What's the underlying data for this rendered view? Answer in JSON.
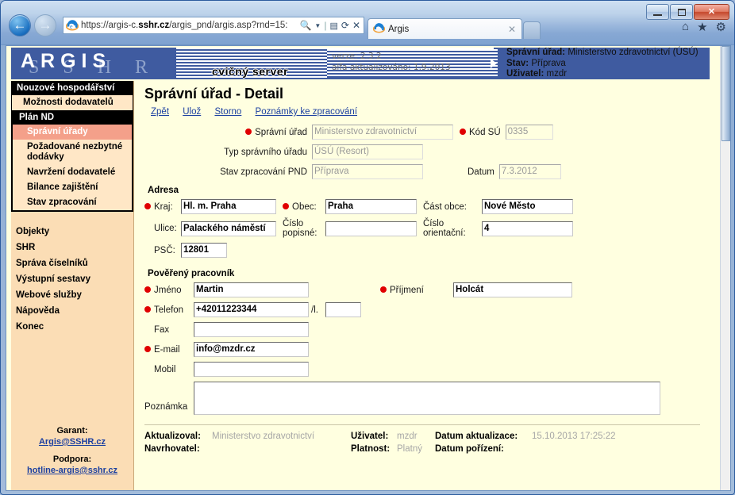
{
  "browser": {
    "url_prefix": "https://argis-c.",
    "url_domain": "sshr.cz",
    "url_suffix": "/argis_pnd/argis.asp?rnd=15:",
    "tab_title": "Argis",
    "search_icon": "search-icon",
    "compat_icon": "compatibility-view-icon",
    "refresh_icon": "refresh-icon",
    "stop_icon": "stop-icon",
    "home_icon": "home-icon",
    "favorites_icon": "star-icon",
    "tools_icon": "gear-icon",
    "minimize_label": "Minimize",
    "maximize_label": "Maximize",
    "close_label": "Close",
    "back_label": "Back",
    "forward_label": "Forward",
    "new_tab_label": "New tab",
    "tab_close_label": "Close tab"
  },
  "banner": {
    "logo": "ARGIS",
    "logo_ghost": "SSHR",
    "slogan": "cvičný server",
    "version_line1": "verze: 2.3.2",
    "version_line2": "alfa aktualizováno: 1.9.2013",
    "session": [
      {
        "label": "Správní úřad:",
        "value": "Ministerstvo zdravotnictví (ÚSÚ)"
      },
      {
        "label": "Stav:",
        "value": "Příprava"
      },
      {
        "label": "Uživatel:",
        "value": "mzdr"
      }
    ]
  },
  "sidebar": {
    "menu_header": "Nouzové hospodářství",
    "menu_item": "Možnosti dodavatelů",
    "submenu_header": "Plán ND",
    "submenu_items": [
      {
        "label": "Správní úřady",
        "active": true
      },
      {
        "label": "Požadované nezbytné dodávky",
        "active": false
      },
      {
        "label": "Navržení dodavatelé",
        "active": false
      },
      {
        "label": "Bilance zajištění",
        "active": false
      },
      {
        "label": "Stav zpracování",
        "active": false
      }
    ],
    "root_items": [
      "Objekty",
      "SHR",
      "Správa číselníků",
      "Výstupní sestavy",
      "Webové služby",
      "Nápověda",
      "Konec"
    ],
    "footer": {
      "garant_label": "Garant:",
      "garant_mail": "Argis@SSHR.cz",
      "podpora_label": "Podpora:",
      "podpora_mail": "hotline-argis@sshr.cz"
    }
  },
  "main": {
    "title": "Správní úřad - Detail",
    "actions": [
      "Zpět",
      "Ulož",
      "Storno",
      "Poznámky ke zpracování"
    ],
    "fields": {
      "spravni_urad_label": "Správní úřad",
      "spravni_urad_value": "Ministerstvo zdravotnictví",
      "kod_su_label": "Kód SÚ",
      "kod_su_value": "0335",
      "typ_label": "Typ správního úřadu",
      "typ_value": "ÚSÚ (Resort)",
      "stav_label": "Stav zpracování PND",
      "stav_value": "Příprava",
      "datum_label": "Datum",
      "datum_value": "7.3.2012"
    },
    "adresa": {
      "section_title": "Adresa",
      "kraj_label": "Kraj:",
      "kraj_value": "Hl. m. Praha",
      "obec_label": "Obec:",
      "obec_value": "Praha",
      "cast_obce_label": "Část obce:",
      "cast_obce_value": "Nové Město",
      "ulice_label": "Ulice:",
      "ulice_value": "Palackého náměstí",
      "cislo_popisne_label": "Číslo popisné:",
      "cislo_popisne_value": "",
      "cislo_orientacni_label": "Číslo orientační:",
      "cislo_orientacni_value": "4",
      "psc_label": "PSČ:",
      "psc_value": "12801"
    },
    "pracovnik": {
      "section_title": "Pověřený pracovník",
      "jmeno_label": "Jméno",
      "jmeno_value": "Martin",
      "prijmeni_label": "Příjmení",
      "prijmeni_value": "Holcát",
      "telefon_label": "Telefon",
      "telefon_value": "+42011223344",
      "linka_label": "/l.",
      "linka_value": "",
      "fax_label": "Fax",
      "fax_value": "",
      "email_label": "E-mail",
      "email_value": "info@mzdr.cz",
      "mobil_label": "Mobil",
      "mobil_value": "",
      "poznamka_label": "Poznámka",
      "poznamka_value": ""
    },
    "footer_meta": {
      "aktualizoval_label": "Aktualizoval:",
      "aktualizoval_value": "Ministerstvo zdravotnictví",
      "uzivatel_label": "Uživatel:",
      "uzivatel_value": "mzdr",
      "datum_aktualizace_label": "Datum aktualizace:",
      "datum_aktualizace_value": "15.10.2013 17:25:22",
      "navrhovatel_label": "Navrhovatel:",
      "navrhovatel_value": "",
      "platnost_label": "Platnost:",
      "platnost_value": "Platný",
      "datum_porizeni_label": "Datum pořízení:",
      "datum_porizeni_value": ""
    }
  },
  "colors": {
    "banner_blue": "#3f5ba0",
    "sidebar_peach": "#fbddb5",
    "page_cream": "#ffffe0",
    "active_item": "#f4a08a",
    "required_dot": "#e00000",
    "link_blue": "#1b3fa0"
  }
}
